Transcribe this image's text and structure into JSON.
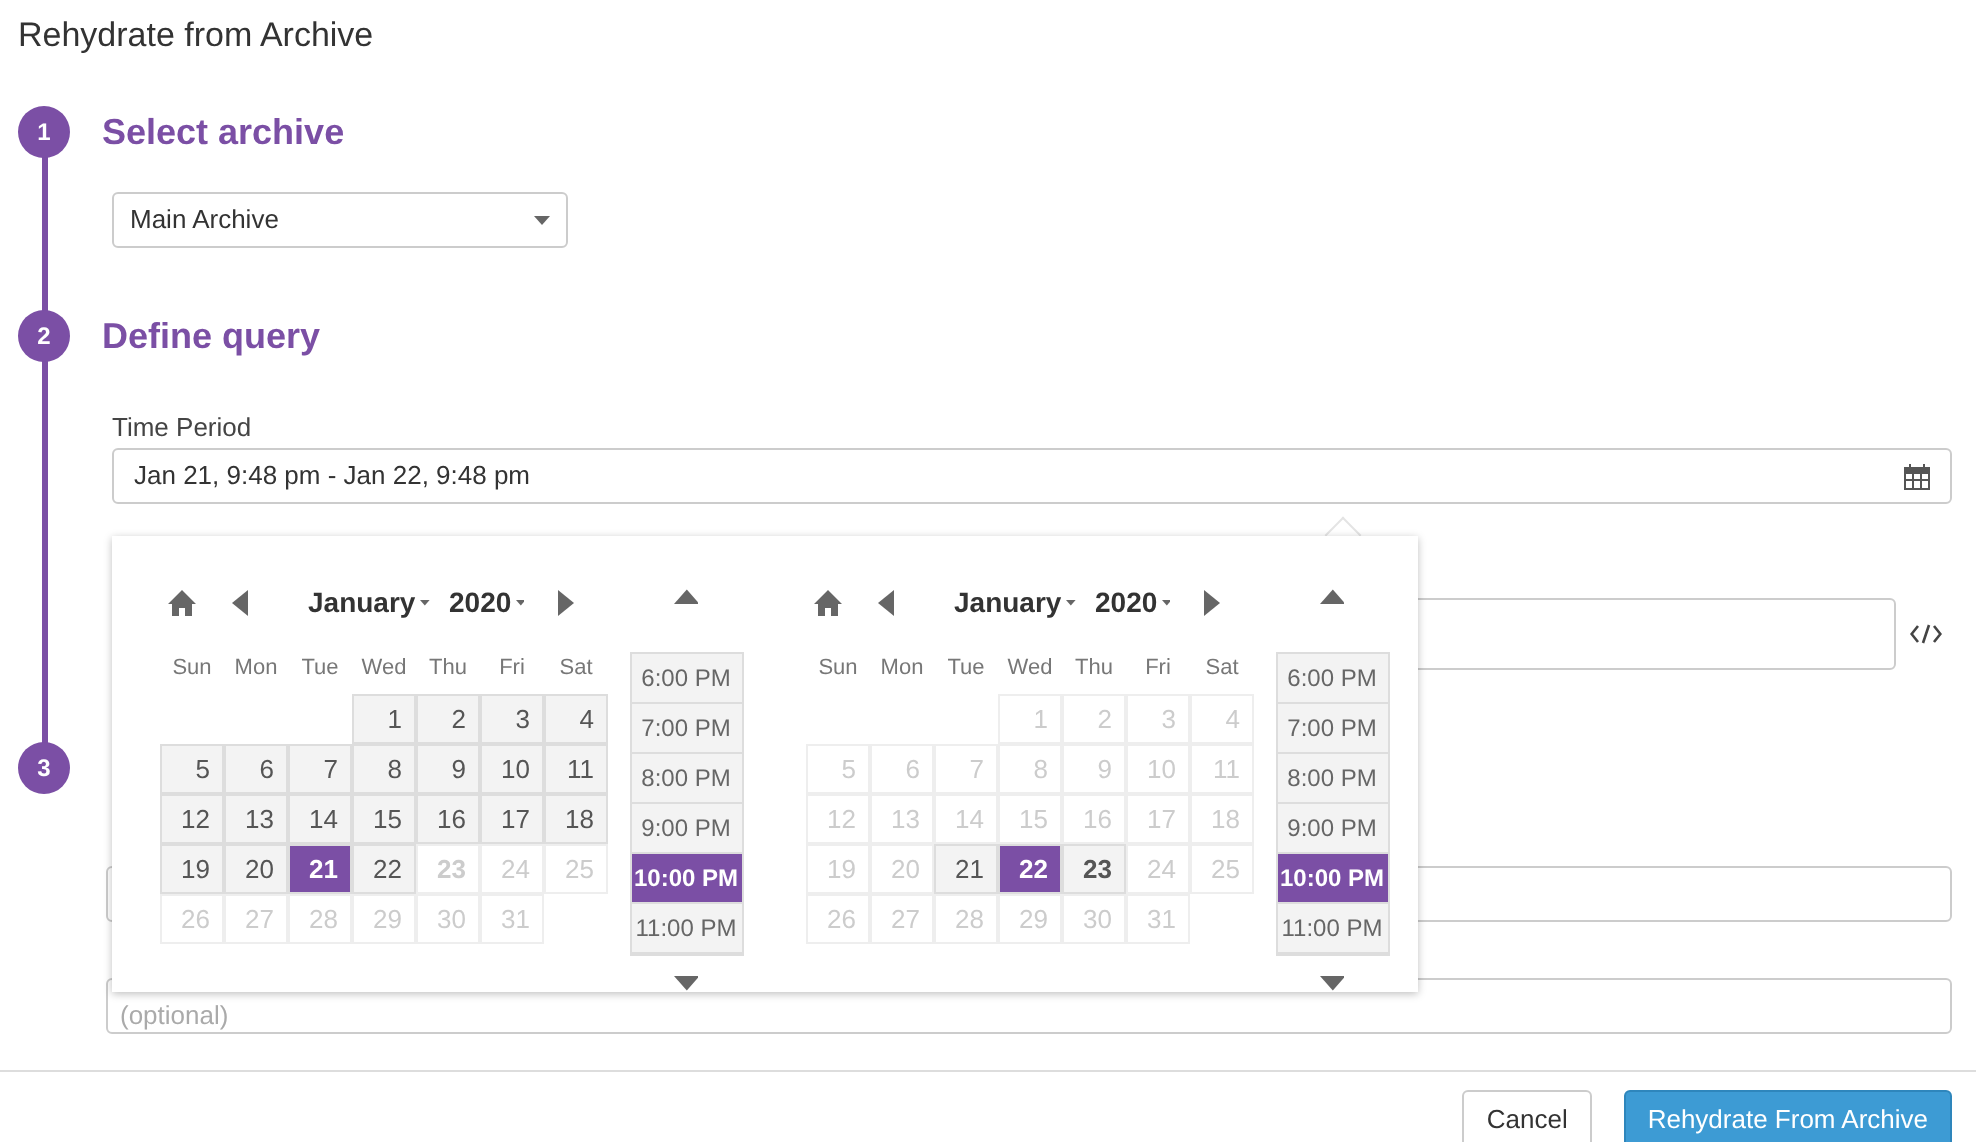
{
  "dialog_title": "Rehydrate from Archive",
  "steps": [
    {
      "number": "1",
      "title": "Select archive"
    },
    {
      "number": "2",
      "title": "Define query"
    },
    {
      "number": "3"
    }
  ],
  "archive_select": {
    "value": "Main Archive"
  },
  "time_period": {
    "label": "Time Period",
    "value": "Jan 21, 9:48 pm - Jan 22, 9:48 pm"
  },
  "optional_field": {
    "placeholder": "(optional)"
  },
  "calendars": [
    {
      "month": "January",
      "year": "2020",
      "weekdays": [
        "Sun",
        "Mon",
        "Tue",
        "Wed",
        "Thu",
        "Fri",
        "Sat"
      ],
      "weeks": [
        [
          {
            "day": "1",
            "kind": "enabled",
            "selected": false,
            "today": false
          },
          {
            "day": "2",
            "kind": "enabled",
            "selected": false,
            "today": false
          },
          {
            "day": "3",
            "kind": "enabled",
            "selected": false,
            "today": false
          },
          {
            "day": "4",
            "kind": "enabled",
            "selected": false,
            "today": false
          }
        ],
        [
          {
            "day": "5",
            "kind": "enabled",
            "selected": false,
            "today": false
          },
          {
            "day": "6",
            "kind": "enabled",
            "selected": false,
            "today": false
          },
          {
            "day": "7",
            "kind": "enabled",
            "selected": false,
            "today": false
          },
          {
            "day": "8",
            "kind": "enabled",
            "selected": false,
            "today": false
          },
          {
            "day": "9",
            "kind": "enabled",
            "selected": false,
            "today": false
          },
          {
            "day": "10",
            "kind": "enabled",
            "selected": false,
            "today": false
          },
          {
            "day": "11",
            "kind": "enabled",
            "selected": false,
            "today": false
          }
        ],
        [
          {
            "day": "12",
            "kind": "enabled",
            "selected": false,
            "today": false
          },
          {
            "day": "13",
            "kind": "enabled",
            "selected": false,
            "today": false
          },
          {
            "day": "14",
            "kind": "enabled",
            "selected": false,
            "today": false
          },
          {
            "day": "15",
            "kind": "enabled",
            "selected": false,
            "today": false
          },
          {
            "day": "16",
            "kind": "enabled",
            "selected": false,
            "today": false
          },
          {
            "day": "17",
            "kind": "enabled",
            "selected": false,
            "today": false
          },
          {
            "day": "18",
            "kind": "enabled",
            "selected": false,
            "today": false
          }
        ],
        [
          {
            "day": "19",
            "kind": "enabled",
            "selected": false,
            "today": false
          },
          {
            "day": "20",
            "kind": "enabled",
            "selected": false,
            "today": false
          },
          {
            "day": "21",
            "kind": "enabled",
            "selected": true,
            "today": false
          },
          {
            "day": "22",
            "kind": "enabled",
            "selected": false,
            "today": false
          },
          {
            "day": "23",
            "kind": "disabled",
            "selected": false,
            "today": true
          },
          {
            "day": "24",
            "kind": "disabled",
            "selected": false,
            "today": false
          },
          {
            "day": "25",
            "kind": "disabled",
            "selected": false,
            "today": false
          }
        ],
        [
          {
            "day": "26",
            "kind": "disabled",
            "selected": false,
            "today": false
          },
          {
            "day": "27",
            "kind": "disabled",
            "selected": false,
            "today": false
          },
          {
            "day": "28",
            "kind": "disabled",
            "selected": false,
            "today": false
          },
          {
            "day": "29",
            "kind": "disabled",
            "selected": false,
            "today": false
          },
          {
            "day": "30",
            "kind": "disabled",
            "selected": false,
            "today": false
          },
          {
            "day": "31",
            "kind": "disabled",
            "selected": false,
            "today": false
          }
        ]
      ],
      "times": [
        {
          "label": "6:00 PM",
          "selected": false
        },
        {
          "label": "7:00 PM",
          "selected": false
        },
        {
          "label": "8:00 PM",
          "selected": false
        },
        {
          "label": "9:00 PM",
          "selected": false
        },
        {
          "label": "10:00 PM",
          "selected": true
        },
        {
          "label": "11:00 PM",
          "selected": false
        }
      ]
    },
    {
      "month": "January",
      "year": "2020",
      "weekdays": [
        "Sun",
        "Mon",
        "Tue",
        "Wed",
        "Thu",
        "Fri",
        "Sat"
      ],
      "weeks": [
        [
          {
            "day": "1",
            "kind": "disabled",
            "selected": false,
            "today": false
          },
          {
            "day": "2",
            "kind": "disabled",
            "selected": false,
            "today": false
          },
          {
            "day": "3",
            "kind": "disabled",
            "selected": false,
            "today": false
          },
          {
            "day": "4",
            "kind": "disabled",
            "selected": false,
            "today": false
          }
        ],
        [
          {
            "day": "5",
            "kind": "disabled",
            "selected": false,
            "today": false
          },
          {
            "day": "6",
            "kind": "disabled",
            "selected": false,
            "today": false
          },
          {
            "day": "7",
            "kind": "disabled",
            "selected": false,
            "today": false
          },
          {
            "day": "8",
            "kind": "disabled",
            "selected": false,
            "today": false
          },
          {
            "day": "9",
            "kind": "disabled",
            "selected": false,
            "today": false
          },
          {
            "day": "10",
            "kind": "disabled",
            "selected": false,
            "today": false
          },
          {
            "day": "11",
            "kind": "disabled",
            "selected": false,
            "today": false
          }
        ],
        [
          {
            "day": "12",
            "kind": "disabled",
            "selected": false,
            "today": false
          },
          {
            "day": "13",
            "kind": "disabled",
            "selected": false,
            "today": false
          },
          {
            "day": "14",
            "kind": "disabled",
            "selected": false,
            "today": false
          },
          {
            "day": "15",
            "kind": "disabled",
            "selected": false,
            "today": false
          },
          {
            "day": "16",
            "kind": "disabled",
            "selected": false,
            "today": false
          },
          {
            "day": "17",
            "kind": "disabled",
            "selected": false,
            "today": false
          },
          {
            "day": "18",
            "kind": "disabled",
            "selected": false,
            "today": false
          }
        ],
        [
          {
            "day": "19",
            "kind": "disabled",
            "selected": false,
            "today": false
          },
          {
            "day": "20",
            "kind": "disabled",
            "selected": false,
            "today": false
          },
          {
            "day": "21",
            "kind": "enabled",
            "selected": false,
            "today": false
          },
          {
            "day": "22",
            "kind": "enabled",
            "selected": true,
            "today": false
          },
          {
            "day": "23",
            "kind": "enabled",
            "selected": false,
            "today": true
          },
          {
            "day": "24",
            "kind": "disabled",
            "selected": false,
            "today": false
          },
          {
            "day": "25",
            "kind": "disabled",
            "selected": false,
            "today": false
          }
        ],
        [
          {
            "day": "26",
            "kind": "disabled",
            "selected": false,
            "today": false
          },
          {
            "day": "27",
            "kind": "disabled",
            "selected": false,
            "today": false
          },
          {
            "day": "28",
            "kind": "disabled",
            "selected": false,
            "today": false
          },
          {
            "day": "29",
            "kind": "disabled",
            "selected": false,
            "today": false
          },
          {
            "day": "30",
            "kind": "disabled",
            "selected": false,
            "today": false
          },
          {
            "day": "31",
            "kind": "disabled",
            "selected": false,
            "today": false
          }
        ]
      ],
      "times": [
        {
          "label": "6:00 PM",
          "selected": false
        },
        {
          "label": "7:00 PM",
          "selected": false
        },
        {
          "label": "8:00 PM",
          "selected": false
        },
        {
          "label": "9:00 PM",
          "selected": false
        },
        {
          "label": "10:00 PM",
          "selected": true
        },
        {
          "label": "11:00 PM",
          "selected": false
        }
      ]
    }
  ],
  "buttons": [
    {
      "label": "Cancel",
      "kind": "secondary"
    },
    {
      "label": "Rehydrate From Archive",
      "kind": "primary"
    }
  ]
}
